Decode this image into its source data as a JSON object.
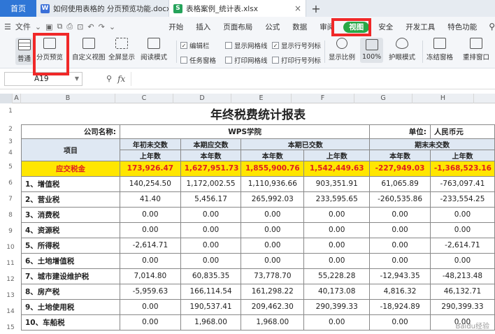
{
  "tabs": {
    "home": "首页",
    "doc1": "如何使用表格的 分页预览功能.docx",
    "doc2": "表格案例_统计表.xlsx",
    "close": "×",
    "add": "+"
  },
  "menu": {
    "file": "文件",
    "items": [
      "开始",
      "插入",
      "页面布局",
      "公式",
      "数据",
      "审阅",
      "视图",
      "安全",
      "开发工具",
      "特色功能"
    ],
    "active": "视图"
  },
  "ribbon": {
    "normal": "普通",
    "page_break_preview": "分页预览",
    "custom_view": "自定义视图",
    "full_screen": "全屏显示",
    "reading_mode": "阅读模式",
    "edit_bar": "编辑栏",
    "show_gridlines": "显示网格线",
    "show_row_col_headers": "显示行号列标",
    "task_pane": "任务窗格",
    "print_gridlines": "打印网格线",
    "print_row_col_headers": "打印行号列标",
    "zoom_ratio": "显示比例",
    "zoom_value": "100%",
    "eye_protection": "护眼模式",
    "freeze_panes": "冻结窗格",
    "rearrange_window": "重排窗口"
  },
  "formula_bar": {
    "name_box": "A19",
    "fx": "fx"
  },
  "columns": [
    "A",
    "B",
    "C",
    "D",
    "E",
    "F",
    "G",
    "H"
  ],
  "rows": [
    "1",
    "2",
    "3",
    "4",
    "5",
    "6",
    "7",
    "8",
    "9",
    "10",
    "11",
    "12",
    "13",
    "14",
    "15"
  ],
  "report": {
    "title": "年终税费统计报表",
    "company_label": "公司名称:",
    "company_name": "WPS学院",
    "unit_label": "单位:",
    "unit_value": "人民币元",
    "item_header": "项目",
    "group_headers": [
      "年初未交数",
      "本期应交数",
      "本期已交数",
      "期末未交数"
    ],
    "sub_headers": [
      "上年数",
      "本年数",
      "本年数",
      "上年数",
      "本年数",
      "上年数"
    ],
    "tax_label": "应交税金",
    "tax_values": [
      "173,926.47",
      "1,627,951.73",
      "1,855,900.76",
      "1,542,449.63",
      "-227,949.03",
      "-1,368,523.16"
    ],
    "rows": [
      {
        "name": "1、增值税",
        "v": [
          "140,254.50",
          "1,172,002.55",
          "1,110,936.66",
          "903,351.91",
          "61,065.89",
          "-763,097.41"
        ]
      },
      {
        "name": "2、营业税",
        "v": [
          "41.40",
          "5,456.17",
          "265,992.03",
          "233,595.65",
          "-260,535.86",
          "-233,554.25"
        ]
      },
      {
        "name": "3、消费税",
        "v": [
          "0.00",
          "0.00",
          "0.00",
          "0.00",
          "0.00",
          "0.00"
        ]
      },
      {
        "name": "4、资源税",
        "v": [
          "0.00",
          "0.00",
          "0.00",
          "0.00",
          "0.00",
          "0.00"
        ]
      },
      {
        "name": "5、所得税",
        "v": [
          "-2,614.71",
          "0.00",
          "0.00",
          "0.00",
          "0.00",
          "-2,614.71"
        ]
      },
      {
        "name": "6、土地增值税",
        "v": [
          "0.00",
          "0.00",
          "0.00",
          "0.00",
          "0.00",
          "0.00"
        ]
      },
      {
        "name": "7、城市建设维护税",
        "v": [
          "7,014.80",
          "60,835.35",
          "73,778.70",
          "55,228.28",
          "-12,943.35",
          "-48,213.48"
        ]
      },
      {
        "name": "8、房产税",
        "v": [
          "-5,959.63",
          "166,114.54",
          "161,298.22",
          "40,173.08",
          "4,816.32",
          "46,132.71"
        ]
      },
      {
        "name": "9、土地使用税",
        "v": [
          "0.00",
          "190,537.41",
          "209,462.30",
          "290,399.33",
          "-18,924.89",
          "290,399.33"
        ]
      },
      {
        "name": "10、车船税",
        "v": [
          "0.00",
          "1,968.00",
          "1,968.00",
          "0.00",
          "0.00",
          "0.00"
        ]
      }
    ]
  },
  "watermark": "Baidu经验"
}
